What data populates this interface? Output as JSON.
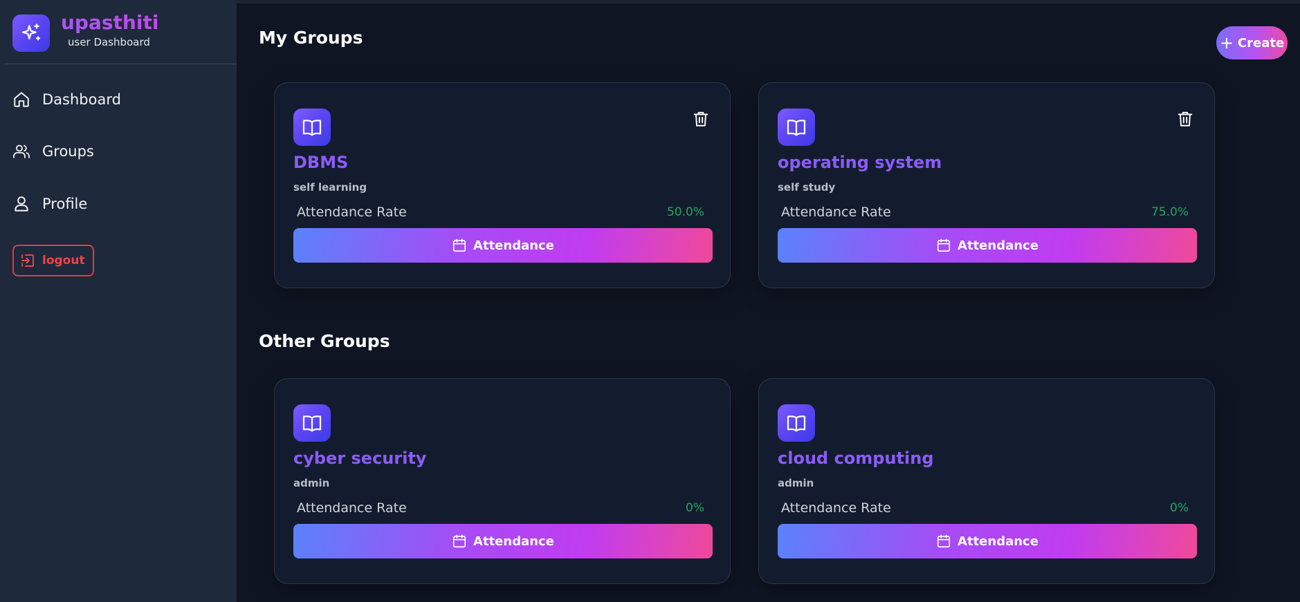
{
  "app": {
    "title": "upasthiti",
    "subtitle": "user Dashboard",
    "brand_icon": "sparkles-icon"
  },
  "sidebar": {
    "items": [
      {
        "label": "Dashboard",
        "icon": "home-icon"
      },
      {
        "label": "Groups",
        "icon": "users-icon"
      },
      {
        "label": "Profile",
        "icon": "user-icon"
      }
    ],
    "logout_label": "logout",
    "logout_icon": "log-in-icon"
  },
  "header": {
    "create_label": "Create"
  },
  "sections": {
    "my_groups_title": "My Groups",
    "other_groups_title": "Other Groups"
  },
  "my_groups": [
    {
      "name": "DBMS",
      "description": "self learning",
      "rate_label": "Attendance Rate",
      "rate": "50.0%",
      "button": "Attendance"
    },
    {
      "name": "operating system",
      "description": "self study",
      "rate_label": "Attendance Rate",
      "rate": "75.0%",
      "button": "Attendance"
    }
  ],
  "other_groups": [
    {
      "name": "cyber security",
      "description": "admin",
      "rate_label": "Attendance Rate",
      "rate": "0%",
      "button": "Attendance"
    },
    {
      "name": "cloud computing",
      "description": "admin",
      "rate_label": "Attendance Rate",
      "rate": "0%",
      "button": "Attendance"
    }
  ],
  "colors": {
    "accent_purple": "#8b5cf6",
    "success_green": "#22a65a",
    "danger_red": "#ef4444",
    "background": "#0f1523",
    "sidebar": "#1e293b"
  }
}
